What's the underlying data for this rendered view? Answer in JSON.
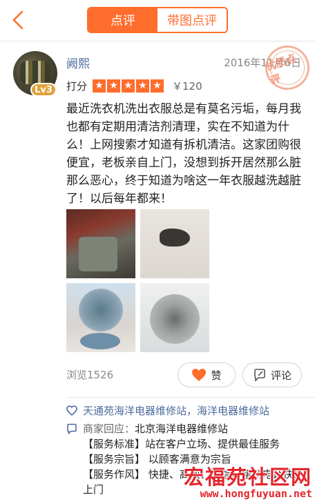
{
  "header": {
    "tabs": [
      {
        "label": "点评",
        "active": true
      },
      {
        "label": "带图点评",
        "active": false
      }
    ],
    "accent": "#ff6d2d"
  },
  "review": {
    "user": {
      "name": "阙熙",
      "level": "Lv3"
    },
    "date": "2016年11月6日",
    "stamp": "优质点评",
    "rating": {
      "label": "打分",
      "stars": 5,
      "price": "￥120"
    },
    "text": "最近洗衣机洗出衣服总是有莫名污垢，每月我也都有定期用清洁剂清理，实在不知道为什么！上网搜索才知道有拆机清洁。这家团购很便宜，老板亲自上门，没想到拆开居然那么脏那么恶心，终于知道为啥这一年衣服越洗越脏了！以后每年都来！",
    "photos": [
      "washer-photo-1",
      "washer-photo-2",
      "washer-photo-3",
      "washer-photo-4"
    ],
    "views": "浏览1526",
    "actions": {
      "like_label": "赞",
      "comment_label": "评论"
    }
  },
  "shops": {
    "text": "天通苑海洋电器维修站，海洋电器维修站"
  },
  "merchant_reply": {
    "label": "商家回应：",
    "name": "北京海洋电器维修站",
    "lines": [
      "【服务标准】站在客户立场、提供最佳服务",
      "【服务宗旨】 以顾客满意为宗旨",
      "【服务作风】 快捷、高效、诚信，接到电话快速上门"
    ]
  },
  "watermark": {
    "title": "宏福苑社区网",
    "url": "www.hongfuyuan.net"
  },
  "colors": {
    "accent": "#ff6d2d",
    "link": "#4b6a9a",
    "heart": "#ff6d2d",
    "watermark": "#e3262d"
  }
}
